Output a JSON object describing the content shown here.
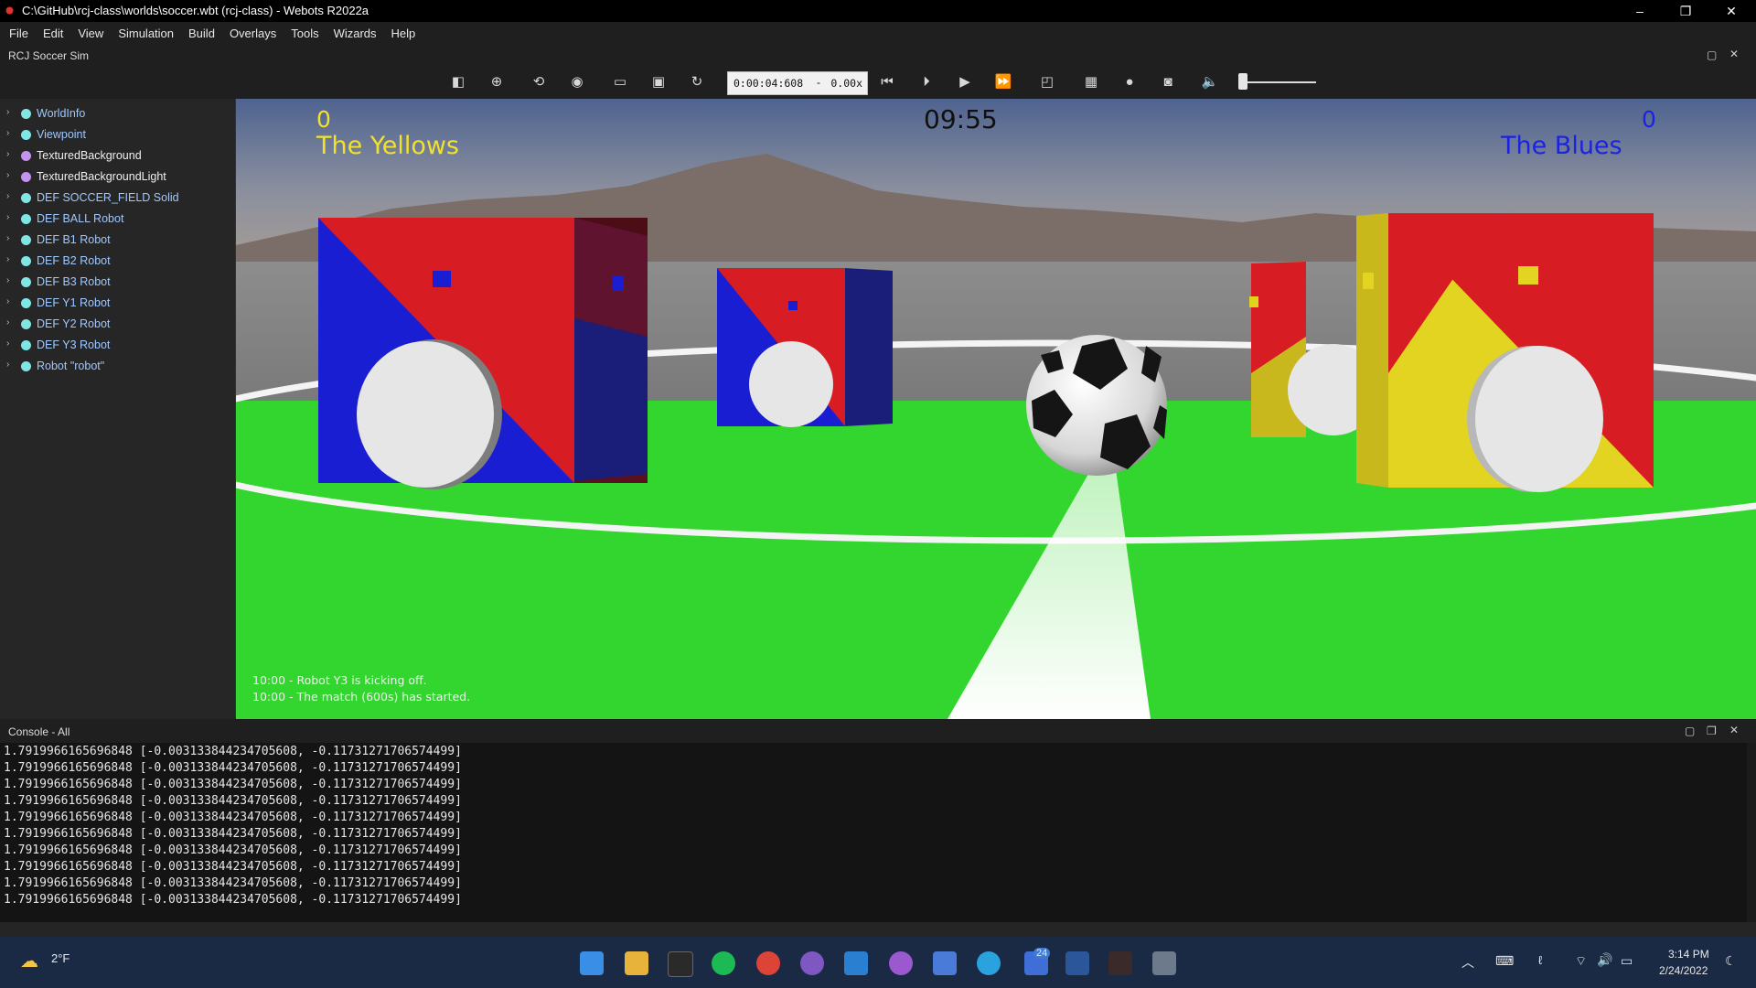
{
  "window": {
    "title": "C:\\GitHub\\rcj-class\\worlds\\soccer.wbt (rcj-class) - Webots R2022a",
    "controls": [
      "–",
      "❐",
      "✕"
    ]
  },
  "menu": [
    "File",
    "Edit",
    "View",
    "Simulation",
    "Build",
    "Overlays",
    "Tools",
    "Wizards",
    "Help"
  ],
  "sim_label": "RCJ Soccer Sim",
  "toolbar": {
    "time": "0:00:04:608",
    "separator": "-",
    "speed": "0.00x",
    "icons": [
      "sidebar-toggle-icon",
      "add-node-icon",
      "reset-view-icon",
      "eye-icon",
      "open-folder-icon",
      "save-icon",
      "reload-icon",
      "reset-simulation-icon",
      "step-icon",
      "play-icon",
      "fast-forward-icon",
      "view-mode-icon",
      "record-movie-icon",
      "record-animation-icon",
      "screenshot-icon",
      "mute-icon"
    ],
    "volume": 0.05
  },
  "scene_tree": [
    {
      "label": "WorldInfo",
      "color": "#7fe6e6",
      "text_color": "#9fc8ff"
    },
    {
      "label": "Viewpoint",
      "color": "#7fe6e6",
      "text_color": "#9fc8ff"
    },
    {
      "label": "TexturedBackground",
      "color": "#c592f0",
      "text_color": "#f0f0f0"
    },
    {
      "label": "TexturedBackgroundLight",
      "color": "#c592f0",
      "text_color": "#f0f0f0"
    },
    {
      "label": "DEF SOCCER_FIELD Solid",
      "color": "#7fe6e6",
      "text_color": "#9fc8ff"
    },
    {
      "label": "DEF BALL Robot",
      "color": "#7fe6e6",
      "text_color": "#9fc8ff"
    },
    {
      "label": "DEF B1 Robot",
      "color": "#7fe6e6",
      "text_color": "#9fc8ff"
    },
    {
      "label": "DEF B2 Robot",
      "color": "#7fe6e6",
      "text_color": "#9fc8ff"
    },
    {
      "label": "DEF B3 Robot",
      "color": "#7fe6e6",
      "text_color": "#9fc8ff"
    },
    {
      "label": "DEF Y1 Robot",
      "color": "#7fe6e6",
      "text_color": "#9fc8ff"
    },
    {
      "label": "DEF Y2 Robot",
      "color": "#7fe6e6",
      "text_color": "#9fc8ff"
    },
    {
      "label": "DEF Y3 Robot",
      "color": "#7fe6e6",
      "text_color": "#9fc8ff"
    },
    {
      "label": "Robot \"robot\"",
      "color": "#7fe6e6",
      "text_color": "#9fc8ff"
    }
  ],
  "view": {
    "score_yellow": "0",
    "team_yellow": "The Yellows",
    "clock": "09:55",
    "score_blue": "0",
    "team_blue": "The Blues",
    "log": [
      "10:00 - Robot Y3 is kicking off.",
      "10:00 - The match (600s) has started."
    ]
  },
  "console": {
    "title": "Console - All",
    "lines": [
      "1.7919966165696848 [-0.003133844234705608, -0.11731271706574499]",
      "1.7919966165696848 [-0.003133844234705608, -0.11731271706574499]",
      "1.7919966165696848 [-0.003133844234705608, -0.11731271706574499]",
      "1.7919966165696848 [-0.003133844234705608, -0.11731271706574499]",
      "1.7919966165696848 [-0.003133844234705608, -0.11731271706574499]",
      "1.7919966165696848 [-0.003133844234705608, -0.11731271706574499]",
      "1.7919966165696848 [-0.003133844234705608, -0.11731271706574499]",
      "1.7919966165696848 [-0.003133844234705608, -0.11731271706574499]",
      "1.7919966165696848 [-0.003133844234705608, -0.11731271706574499]",
      "1.7919966165696848 [-0.003133844234705608, -0.11731271706574499]"
    ]
  },
  "taskbar": {
    "weather": "2°F",
    "time": "3:14 PM",
    "date": "2/24/2022",
    "badge": "24",
    "apps": [
      "start-icon",
      "file-explorer-icon",
      "terminal-icon",
      "spotify-icon",
      "chrome-icon",
      "app-icon",
      "vscode-icon",
      "github-icon",
      "network-app-icon",
      "telegram-icon",
      "teams-icon",
      "word-icon",
      "webots-icon",
      "calculator-icon"
    ]
  }
}
